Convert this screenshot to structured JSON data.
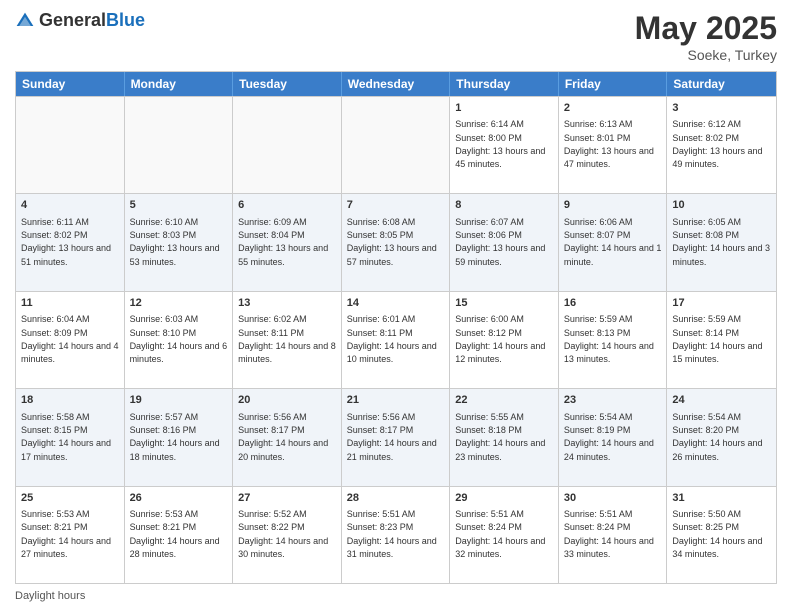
{
  "header": {
    "logo_general": "General",
    "logo_blue": "Blue",
    "month": "May 2025",
    "location": "Soeke, Turkey"
  },
  "days_of_week": [
    "Sunday",
    "Monday",
    "Tuesday",
    "Wednesday",
    "Thursday",
    "Friday",
    "Saturday"
  ],
  "footer": "Daylight hours",
  "weeks": [
    [
      {
        "day": "",
        "info": ""
      },
      {
        "day": "",
        "info": ""
      },
      {
        "day": "",
        "info": ""
      },
      {
        "day": "",
        "info": ""
      },
      {
        "day": "1",
        "info": "Sunrise: 6:14 AM\nSunset: 8:00 PM\nDaylight: 13 hours and 45 minutes."
      },
      {
        "day": "2",
        "info": "Sunrise: 6:13 AM\nSunset: 8:01 PM\nDaylight: 13 hours and 47 minutes."
      },
      {
        "day": "3",
        "info": "Sunrise: 6:12 AM\nSunset: 8:02 PM\nDaylight: 13 hours and 49 minutes."
      }
    ],
    [
      {
        "day": "4",
        "info": "Sunrise: 6:11 AM\nSunset: 8:02 PM\nDaylight: 13 hours and 51 minutes."
      },
      {
        "day": "5",
        "info": "Sunrise: 6:10 AM\nSunset: 8:03 PM\nDaylight: 13 hours and 53 minutes."
      },
      {
        "day": "6",
        "info": "Sunrise: 6:09 AM\nSunset: 8:04 PM\nDaylight: 13 hours and 55 minutes."
      },
      {
        "day": "7",
        "info": "Sunrise: 6:08 AM\nSunset: 8:05 PM\nDaylight: 13 hours and 57 minutes."
      },
      {
        "day": "8",
        "info": "Sunrise: 6:07 AM\nSunset: 8:06 PM\nDaylight: 13 hours and 59 minutes."
      },
      {
        "day": "9",
        "info": "Sunrise: 6:06 AM\nSunset: 8:07 PM\nDaylight: 14 hours and 1 minute."
      },
      {
        "day": "10",
        "info": "Sunrise: 6:05 AM\nSunset: 8:08 PM\nDaylight: 14 hours and 3 minutes."
      }
    ],
    [
      {
        "day": "11",
        "info": "Sunrise: 6:04 AM\nSunset: 8:09 PM\nDaylight: 14 hours and 4 minutes."
      },
      {
        "day": "12",
        "info": "Sunrise: 6:03 AM\nSunset: 8:10 PM\nDaylight: 14 hours and 6 minutes."
      },
      {
        "day": "13",
        "info": "Sunrise: 6:02 AM\nSunset: 8:11 PM\nDaylight: 14 hours and 8 minutes."
      },
      {
        "day": "14",
        "info": "Sunrise: 6:01 AM\nSunset: 8:11 PM\nDaylight: 14 hours and 10 minutes."
      },
      {
        "day": "15",
        "info": "Sunrise: 6:00 AM\nSunset: 8:12 PM\nDaylight: 14 hours and 12 minutes."
      },
      {
        "day": "16",
        "info": "Sunrise: 5:59 AM\nSunset: 8:13 PM\nDaylight: 14 hours and 13 minutes."
      },
      {
        "day": "17",
        "info": "Sunrise: 5:59 AM\nSunset: 8:14 PM\nDaylight: 14 hours and 15 minutes."
      }
    ],
    [
      {
        "day": "18",
        "info": "Sunrise: 5:58 AM\nSunset: 8:15 PM\nDaylight: 14 hours and 17 minutes."
      },
      {
        "day": "19",
        "info": "Sunrise: 5:57 AM\nSunset: 8:16 PM\nDaylight: 14 hours and 18 minutes."
      },
      {
        "day": "20",
        "info": "Sunrise: 5:56 AM\nSunset: 8:17 PM\nDaylight: 14 hours and 20 minutes."
      },
      {
        "day": "21",
        "info": "Sunrise: 5:56 AM\nSunset: 8:17 PM\nDaylight: 14 hours and 21 minutes."
      },
      {
        "day": "22",
        "info": "Sunrise: 5:55 AM\nSunset: 8:18 PM\nDaylight: 14 hours and 23 minutes."
      },
      {
        "day": "23",
        "info": "Sunrise: 5:54 AM\nSunset: 8:19 PM\nDaylight: 14 hours and 24 minutes."
      },
      {
        "day": "24",
        "info": "Sunrise: 5:54 AM\nSunset: 8:20 PM\nDaylight: 14 hours and 26 minutes."
      }
    ],
    [
      {
        "day": "25",
        "info": "Sunrise: 5:53 AM\nSunset: 8:21 PM\nDaylight: 14 hours and 27 minutes."
      },
      {
        "day": "26",
        "info": "Sunrise: 5:53 AM\nSunset: 8:21 PM\nDaylight: 14 hours and 28 minutes."
      },
      {
        "day": "27",
        "info": "Sunrise: 5:52 AM\nSunset: 8:22 PM\nDaylight: 14 hours and 30 minutes."
      },
      {
        "day": "28",
        "info": "Sunrise: 5:51 AM\nSunset: 8:23 PM\nDaylight: 14 hours and 31 minutes."
      },
      {
        "day": "29",
        "info": "Sunrise: 5:51 AM\nSunset: 8:24 PM\nDaylight: 14 hours and 32 minutes."
      },
      {
        "day": "30",
        "info": "Sunrise: 5:51 AM\nSunset: 8:24 PM\nDaylight: 14 hours and 33 minutes."
      },
      {
        "day": "31",
        "info": "Sunrise: 5:50 AM\nSunset: 8:25 PM\nDaylight: 14 hours and 34 minutes."
      }
    ]
  ]
}
